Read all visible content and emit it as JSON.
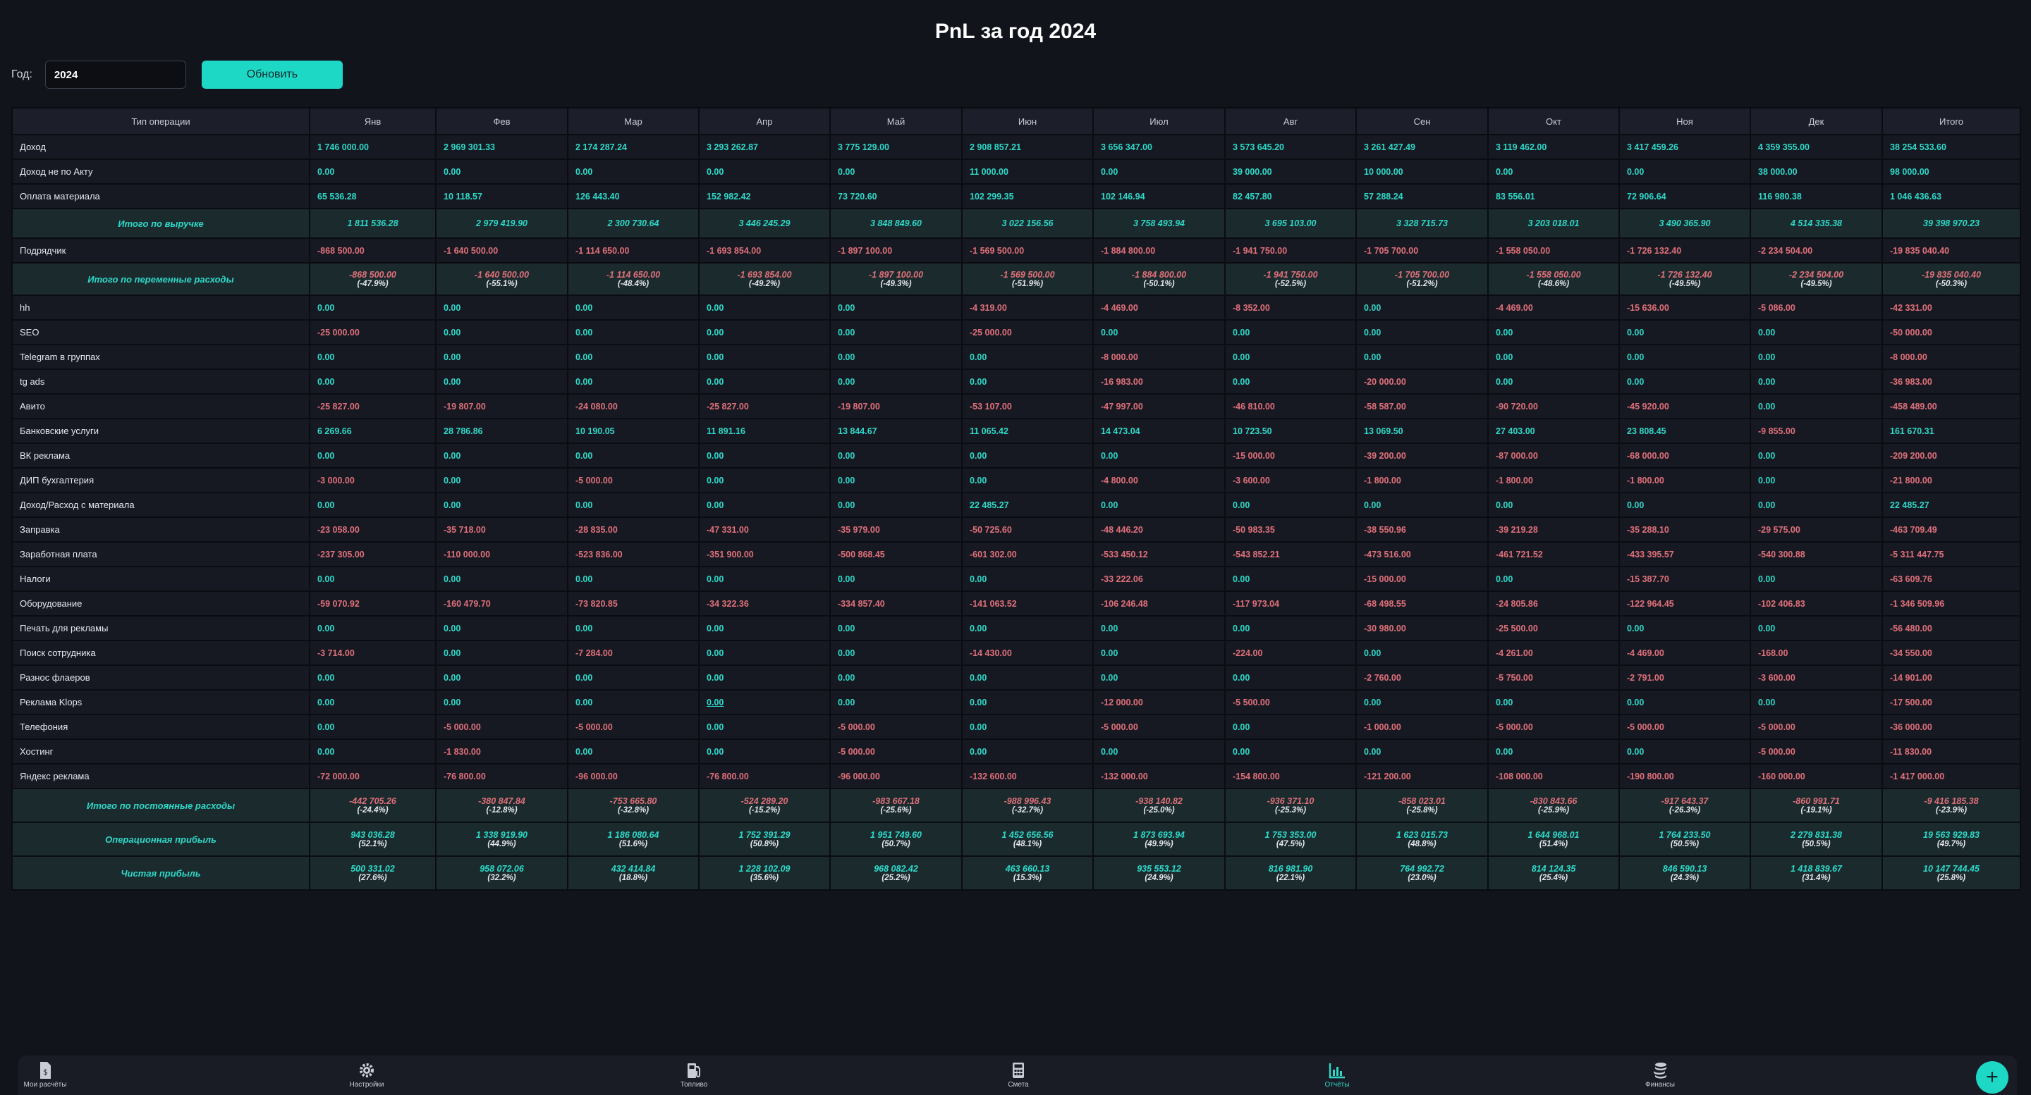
{
  "page": {
    "title": "PnL за год 2024"
  },
  "controls": {
    "year_label": "Год:",
    "year_value": "2024",
    "refresh_label": "Обновить"
  },
  "table": {
    "columns": [
      "Тип операции",
      "Янв",
      "Фев",
      "Мар",
      "Апр",
      "Май",
      "Июн",
      "Июл",
      "Авг",
      "Сен",
      "Окт",
      "Ноя",
      "Дек",
      "Итого"
    ],
    "rows": [
      {
        "type": "normal",
        "label": "Доход",
        "values": [
          "1 746 000.00",
          "2 969 301.33",
          "2 174 287.24",
          "3 293 262.87",
          "3 775 129.00",
          "2 908 857.21",
          "3 656 347.00",
          "3 573 645.20",
          "3 261 427.49",
          "3 119 462.00",
          "3 417 459.26",
          "4 359 355.00",
          "38 254 533.60"
        ]
      },
      {
        "type": "normal",
        "label": "Доход не по Акту",
        "values": [
          "0.00",
          "0.00",
          "0.00",
          "0.00",
          "0.00",
          "11 000.00",
          "0.00",
          "39 000.00",
          "10 000.00",
          "0.00",
          "0.00",
          "38 000.00",
          "98 000.00"
        ]
      },
      {
        "type": "normal",
        "label": "Оплата материала",
        "values": [
          "65 536.28",
          "10 118.57",
          "126 443.40",
          "152 982.42",
          "73 720.60",
          "102 299.35",
          "102 146.94",
          "82 457.80",
          "57 288.24",
          "83 556.01",
          "72 906.64",
          "116 980.38",
          "1 046 436.63"
        ]
      },
      {
        "type": "summary",
        "label": "Итого по выручке",
        "values": [
          "1 811 536.28",
          "2 979 419.90",
          "2 300 730.64",
          "3 446 245.29",
          "3 848 849.60",
          "3 022 156.56",
          "3 758 493.94",
          "3 695 103.00",
          "3 328 715.73",
          "3 203 018.01",
          "3 490 365.90",
          "4 514 335.38",
          "39 398 970.23"
        ]
      },
      {
        "type": "normal",
        "label": "Подрядчик",
        "values": [
          "-868 500.00",
          "-1 640 500.00",
          "-1 114 650.00",
          "-1 693 854.00",
          "-1 897 100.00",
          "-1 569 500.00",
          "-1 884 800.00",
          "-1 941 750.00",
          "-1 705 700.00",
          "-1 558 050.00",
          "-1 726 132.40",
          "-2 234 504.00",
          "-19 835 040.40"
        ]
      },
      {
        "type": "summary2",
        "label": "Итого по переменные расходы",
        "values": [
          "-868 500.00",
          "-1 640 500.00",
          "-1 114 650.00",
          "-1 693 854.00",
          "-1 897 100.00",
          "-1 569 500.00",
          "-1 884 800.00",
          "-1 941 750.00",
          "-1 705 700.00",
          "-1 558 050.00",
          "-1 726 132.40",
          "-2 234 504.00",
          "-19 835 040.40"
        ],
        "pcts": [
          "(-47.9%)",
          "(-55.1%)",
          "(-48.4%)",
          "(-49.2%)",
          "(-49.3%)",
          "(-51.9%)",
          "(-50.1%)",
          "(-52.5%)",
          "(-51.2%)",
          "(-48.6%)",
          "(-49.5%)",
          "(-49.5%)",
          "(-50.3%)"
        ]
      },
      {
        "type": "normal",
        "label": "hh",
        "values": [
          "0.00",
          "0.00",
          "0.00",
          "0.00",
          "0.00",
          "-4 319.00",
          "-4 469.00",
          "-8 352.00",
          "0.00",
          "-4 469.00",
          "-15 636.00",
          "-5 086.00",
          "-42 331.00"
        ]
      },
      {
        "type": "normal",
        "label": "SEO",
        "values": [
          "-25 000.00",
          "0.00",
          "0.00",
          "0.00",
          "0.00",
          "-25 000.00",
          "0.00",
          "0.00",
          "0.00",
          "0.00",
          "0.00",
          "0.00",
          "-50 000.00"
        ]
      },
      {
        "type": "normal",
        "label": "Telegram в группах",
        "values": [
          "0.00",
          "0.00",
          "0.00",
          "0.00",
          "0.00",
          "0.00",
          "-8 000.00",
          "0.00",
          "0.00",
          "0.00",
          "0.00",
          "0.00",
          "-8 000.00"
        ]
      },
      {
        "type": "normal",
        "label": "tg ads",
        "values": [
          "0.00",
          "0.00",
          "0.00",
          "0.00",
          "0.00",
          "0.00",
          "-16 983.00",
          "0.00",
          "-20 000.00",
          "0.00",
          "0.00",
          "0.00",
          "-36 983.00"
        ]
      },
      {
        "type": "normal",
        "label": "Авито",
        "values": [
          "-25 827.00",
          "-19 807.00",
          "-24 080.00",
          "-25 827.00",
          "-19 807.00",
          "-53 107.00",
          "-47 997.00",
          "-46 810.00",
          "-58 587.00",
          "-90 720.00",
          "-45 920.00",
          "0.00",
          "-458 489.00"
        ]
      },
      {
        "type": "normal",
        "label": "Банковские услуги",
        "values": [
          "6 269.66",
          "28 786.86",
          "10 190.05",
          "11 891.16",
          "13 844.67",
          "11 065.42",
          "14 473.04",
          "10 723.50",
          "13 069.50",
          "27 403.00",
          "23 808.45",
          "-9 855.00",
          "161 670.31"
        ]
      },
      {
        "type": "normal",
        "label": "ВК реклама",
        "values": [
          "0.00",
          "0.00",
          "0.00",
          "0.00",
          "0.00",
          "0.00",
          "0.00",
          "-15 000.00",
          "-39 200.00",
          "-87 000.00",
          "-68 000.00",
          "0.00",
          "-209 200.00"
        ]
      },
      {
        "type": "normal",
        "label": "ДИП бухгалтерия",
        "values": [
          "-3 000.00",
          "0.00",
          "-5 000.00",
          "0.00",
          "0.00",
          "0.00",
          "-4 800.00",
          "-3 600.00",
          "-1 800.00",
          "-1 800.00",
          "-1 800.00",
          "0.00",
          "-21 800.00"
        ]
      },
      {
        "type": "normal",
        "label": "Доход/Расход с материала",
        "values": [
          "0.00",
          "0.00",
          "0.00",
          "0.00",
          "0.00",
          "22 485.27",
          "0.00",
          "0.00",
          "0.00",
          "0.00",
          "0.00",
          "0.00",
          "22 485.27"
        ]
      },
      {
        "type": "normal",
        "label": "Заправка",
        "values": [
          "-23 058.00",
          "-35 718.00",
          "-28 835.00",
          "-47 331.00",
          "-35 979.00",
          "-50 725.60",
          "-48 446.20",
          "-50 983.35",
          "-38 550.96",
          "-39 219.28",
          "-35 288.10",
          "-29 575.00",
          "-463 709.49"
        ]
      },
      {
        "type": "normal",
        "label": "Заработная плата",
        "values": [
          "-237 305.00",
          "-110 000.00",
          "-523 836.00",
          "-351 900.00",
          "-500 868.45",
          "-601 302.00",
          "-533 450.12",
          "-543 852.21",
          "-473 516.00",
          "-461 721.52",
          "-433 395.57",
          "-540 300.88",
          "-5 311 447.75"
        ]
      },
      {
        "type": "normal",
        "label": "Налоги",
        "values": [
          "0.00",
          "0.00",
          "0.00",
          "0.00",
          "0.00",
          "0.00",
          "-33 222.06",
          "0.00",
          "-15 000.00",
          "0.00",
          "-15 387.70",
          "0.00",
          "-63 609.76"
        ]
      },
      {
        "type": "normal",
        "label": "Оборудование",
        "values": [
          "-59 070.92",
          "-160 479.70",
          "-73 820.85",
          "-34 322.36",
          "-334 857.40",
          "-141 063.52",
          "-106 246.48",
          "-117 973.04",
          "-68 498.55",
          "-24 805.86",
          "-122 964.45",
          "-102 406.83",
          "-1 346 509.96"
        ]
      },
      {
        "type": "normal",
        "label": "Печать для рекламы",
        "values": [
          "0.00",
          "0.00",
          "0.00",
          "0.00",
          "0.00",
          "0.00",
          "0.00",
          "0.00",
          "-30 980.00",
          "-25 500.00",
          "0.00",
          "0.00",
          "-56 480.00"
        ]
      },
      {
        "type": "normal",
        "label": "Поиск сотрудника",
        "values": [
          "-3 714.00",
          "0.00",
          "-7 284.00",
          "0.00",
          "0.00",
          "-14 430.00",
          "0.00",
          "-224.00",
          "0.00",
          "-4 261.00",
          "-4 469.00",
          "-168.00",
          "-34 550.00"
        ]
      },
      {
        "type": "normal",
        "label": "Разнос флаеров",
        "values": [
          "0.00",
          "0.00",
          "0.00",
          "0.00",
          "0.00",
          "0.00",
          "0.00",
          "0.00",
          "-2 760.00",
          "-5 750.00",
          "-2 791.00",
          "-3 600.00",
          "-14 901.00"
        ]
      },
      {
        "type": "normal",
        "label": "Реклама Klops",
        "values": [
          "0.00",
          "0.00",
          "0.00",
          "0.00",
          "0.00",
          "0.00",
          "-12 000.00",
          "-5 500.00",
          "0.00",
          "0.00",
          "0.00",
          "0.00",
          "-17 500.00"
        ],
        "underline": [
          3
        ]
      },
      {
        "type": "normal",
        "label": "Телефония",
        "values": [
          "0.00",
          "-5 000.00",
          "-5 000.00",
          "0.00",
          "-5 000.00",
          "0.00",
          "-5 000.00",
          "0.00",
          "-1 000.00",
          "-5 000.00",
          "-5 000.00",
          "-5 000.00",
          "-36 000.00"
        ]
      },
      {
        "type": "normal",
        "label": "Хостинг",
        "values": [
          "0.00",
          "-1 830.00",
          "0.00",
          "0.00",
          "-5 000.00",
          "0.00",
          "0.00",
          "0.00",
          "0.00",
          "0.00",
          "0.00",
          "-5 000.00",
          "-11 830.00"
        ]
      },
      {
        "type": "normal",
        "label": "Яндекс реклама",
        "values": [
          "-72 000.00",
          "-76 800.00",
          "-96 000.00",
          "-76 800.00",
          "-96 000.00",
          "-132 600.00",
          "-132 000.00",
          "-154 800.00",
          "-121 200.00",
          "-108 000.00",
          "-190 800.00",
          "-160 000.00",
          "-1 417 000.00"
        ]
      },
      {
        "type": "summary3",
        "label": "Итого по постоянные расходы",
        "values": [
          "-442 705.26",
          "-380 847.84",
          "-753 665.80",
          "-524 289.20",
          "-983 667.18",
          "-988 996.43",
          "-938 140.82",
          "-936 371.10",
          "-858 023.01",
          "-830 843.66",
          "-917 643.37",
          "-860 991.71",
          "-9 416 185.38"
        ],
        "pcts": [
          "(-24.4%)",
          "(-12.8%)",
          "(-32.8%)",
          "(-15.2%)",
          "(-25.6%)",
          "(-32.7%)",
          "(-25.0%)",
          "(-25.3%)",
          "(-25.8%)",
          "(-25.9%)",
          "(-26.3%)",
          "(-19.1%)",
          "(-23.9%)"
        ]
      },
      {
        "type": "summary3",
        "label": "Операционная прибыль",
        "values": [
          "943 036.28",
          "1 338 919.90",
          "1 186 080.64",
          "1 752 391.29",
          "1 951 749.60",
          "1 452 656.56",
          "1 873 693.94",
          "1 753 353.00",
          "1 623 015.73",
          "1 644 968.01",
          "1 764 233.50",
          "2 279 831.38",
          "19 563 929.83"
        ],
        "pcts": [
          "(52.1%)",
          "(44.9%)",
          "(51.6%)",
          "(50.8%)",
          "(50.7%)",
          "(48.1%)",
          "(49.9%)",
          "(47.5%)",
          "(48.8%)",
          "(51.4%)",
          "(50.5%)",
          "(50.5%)",
          "(49.7%)"
        ]
      },
      {
        "type": "summary3",
        "label": "Чистая прибыль",
        "values": [
          "500 331.02",
          "958 072.06",
          "432 414.84",
          "1 228 102.09",
          "968 082.42",
          "463 660.13",
          "935 553.12",
          "816 981.90",
          "764 992.72",
          "814 124.35",
          "846 590.13",
          "1 418 839.67",
          "10 147 744.45"
        ],
        "pcts": [
          "(27.6%)",
          "(32.2%)",
          "(18.8%)",
          "(35.6%)",
          "(25.2%)",
          "(15.3%)",
          "(24.9%)",
          "(22.1%)",
          "(23.0%)",
          "(25.4%)",
          "(24.3%)",
          "(31.4%)",
          "(25.8%)"
        ]
      }
    ]
  },
  "nav": [
    {
      "label": "Мои расчёты",
      "icon": "calculation-doc-icon",
      "active": false
    },
    {
      "label": "Настройки",
      "icon": "gear-icon",
      "active": false
    },
    {
      "label": "Топливо",
      "icon": "fuel-pump-icon",
      "active": false
    },
    {
      "label": "Смета",
      "icon": "calculator-icon",
      "active": false
    },
    {
      "label": "Отчёты",
      "icon": "bar-chart-icon",
      "active": true
    },
    {
      "label": "Финансы",
      "icon": "coins-icon",
      "active": false
    }
  ],
  "fab": {
    "label": "+"
  },
  "colors": {
    "accent": "#1ed8c6",
    "negative": "#e0707a",
    "background": "#12141c"
  }
}
